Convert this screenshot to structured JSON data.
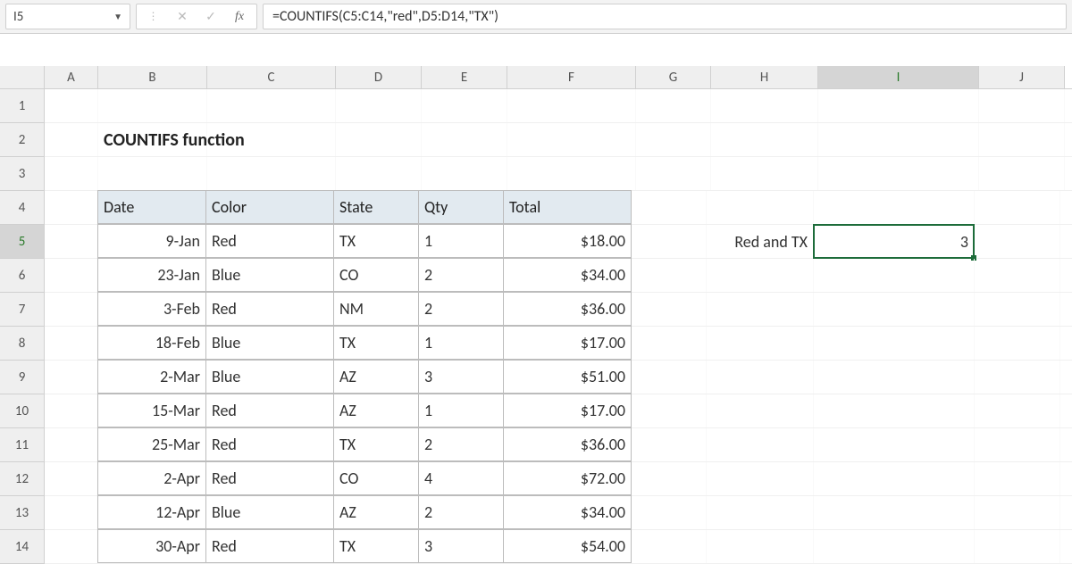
{
  "formula_bar": {
    "cell_ref": "I5",
    "formula": "=COUNTIFS(C5:C14,\"red\",D5:D14,\"TX\")",
    "fx_label": "fx"
  },
  "columns": [
    "A",
    "B",
    "C",
    "D",
    "E",
    "F",
    "G",
    "H",
    "I",
    "J"
  ],
  "active_column": "I",
  "rows": [
    "1",
    "2",
    "3",
    "4",
    "5",
    "6",
    "7",
    "8",
    "9",
    "10",
    "11",
    "12",
    "13",
    "14"
  ],
  "active_row": "5",
  "title": "COUNTIFS function",
  "table": {
    "headers": {
      "date": "Date",
      "color": "Color",
      "state": "State",
      "qty": "Qty",
      "total": "Total"
    },
    "data": [
      {
        "date": "9-Jan",
        "color": "Red",
        "state": "TX",
        "qty": "1",
        "total": "$18.00"
      },
      {
        "date": "23-Jan",
        "color": "Blue",
        "state": "CO",
        "qty": "2",
        "total": "$34.00"
      },
      {
        "date": "3-Feb",
        "color": "Red",
        "state": "NM",
        "qty": "2",
        "total": "$36.00"
      },
      {
        "date": "18-Feb",
        "color": "Blue",
        "state": "TX",
        "qty": "1",
        "total": "$17.00"
      },
      {
        "date": "2-Mar",
        "color": "Blue",
        "state": "AZ",
        "qty": "3",
        "total": "$51.00"
      },
      {
        "date": "15-Mar",
        "color": "Red",
        "state": "AZ",
        "qty": "1",
        "total": "$17.00"
      },
      {
        "date": "25-Mar",
        "color": "Red",
        "state": "TX",
        "qty": "2",
        "total": "$36.00"
      },
      {
        "date": "2-Apr",
        "color": "Red",
        "state": "CO",
        "qty": "4",
        "total": "$72.00"
      },
      {
        "date": "12-Apr",
        "color": "Blue",
        "state": "AZ",
        "qty": "2",
        "total": "$34.00"
      },
      {
        "date": "30-Apr",
        "color": "Red",
        "state": "TX",
        "qty": "3",
        "total": "$54.00"
      }
    ]
  },
  "result": {
    "label": "Red and TX",
    "value": "3"
  }
}
